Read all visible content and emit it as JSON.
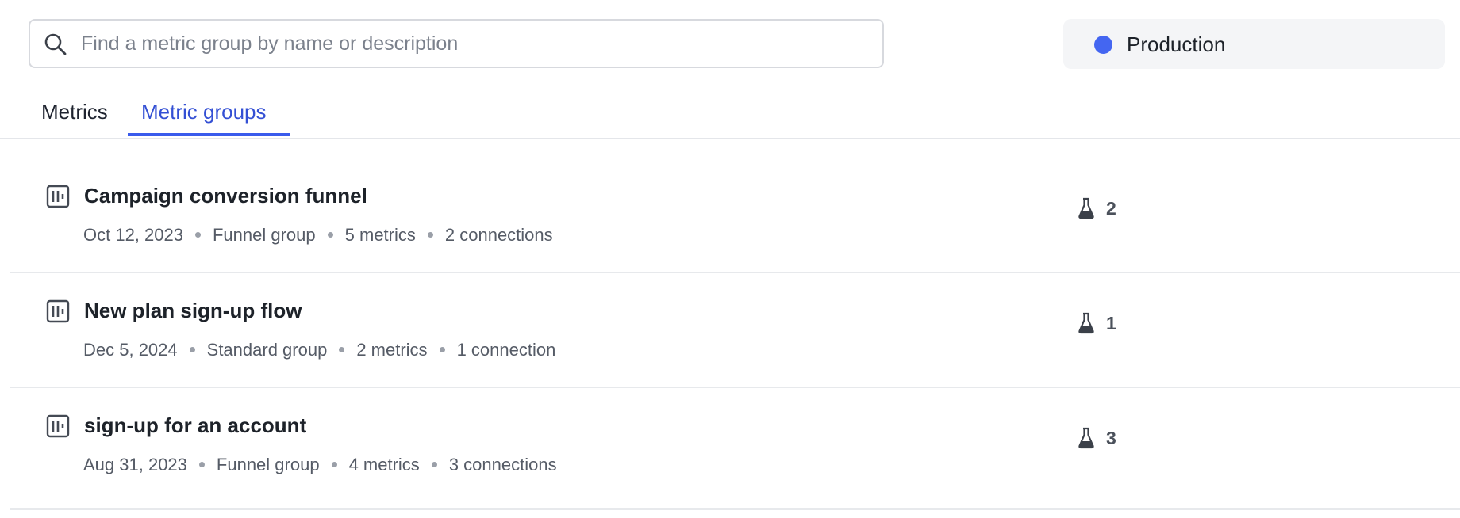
{
  "search": {
    "placeholder": "Find a metric group by name or description",
    "value": ""
  },
  "environment": {
    "label": "Production",
    "color": "#4466f1"
  },
  "tabs": [
    {
      "label": "Metrics",
      "active": false
    },
    {
      "label": "Metric groups",
      "active": true
    }
  ],
  "groups": [
    {
      "title": "Campaign conversion funnel",
      "date": "Oct 12, 2023",
      "type": "Funnel group",
      "metrics": "5 metrics",
      "connections": "2 connections",
      "experiments": "2"
    },
    {
      "title": "New plan sign-up flow",
      "date": "Dec 5, 2024",
      "type": "Standard group",
      "metrics": "2 metrics",
      "connections": "1 connection",
      "experiments": "1"
    },
    {
      "title": "sign-up for an account",
      "date": "Aug 31, 2023",
      "type": "Funnel group",
      "metrics": "4 metrics",
      "connections": "3 connections",
      "experiments": "3"
    }
  ],
  "icons": {
    "search": "search-icon",
    "group": "metric-group-icon",
    "experiment": "flask-icon"
  },
  "colors": {
    "accent": "#3a5bec",
    "active_tab_text": "#3450d4"
  }
}
